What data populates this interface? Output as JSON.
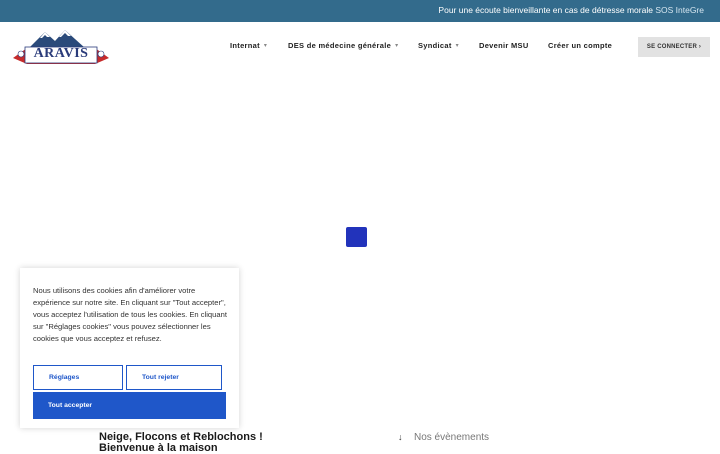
{
  "topbar": {
    "message": "Pour une écoute bienveillante en cas de détresse morale",
    "link": "SOS InteGre"
  },
  "logo": {
    "text": "ARAVIS"
  },
  "nav": {
    "items": [
      {
        "label": "Internat",
        "has_dropdown": true
      },
      {
        "label": "DES de médecine générale",
        "has_dropdown": true
      },
      {
        "label": "Syndicat",
        "has_dropdown": true
      },
      {
        "label": "Devenir MSU",
        "has_dropdown": false
      },
      {
        "label": "Créer un compte",
        "has_dropdown": false
      }
    ],
    "login_label": "SE CONNECTER ›"
  },
  "cookie_banner": {
    "text": "Nous utilisons des cookies afin d'améliorer votre expérience sur notre site. En cliquant sur \"Tout accepter\", vous acceptez l'utilisation de tous les cookies. En cliquant sur \"Réglages cookies\" vous pouvez sélectionner les cookies que vous acceptez et refusez.",
    "settings_label": "Réglages",
    "reject_label": "Tout rejeter",
    "accept_label": "Tout accepter"
  },
  "content": {
    "headline_line1": "Neige, Flocons et Reblochons !",
    "headline_line2": "Bienvenue à la maison",
    "events_label": "Nos évènements"
  },
  "colors": {
    "topbar": "#336b8c",
    "accent": "#1f57c9",
    "loader": "#2233bb"
  }
}
